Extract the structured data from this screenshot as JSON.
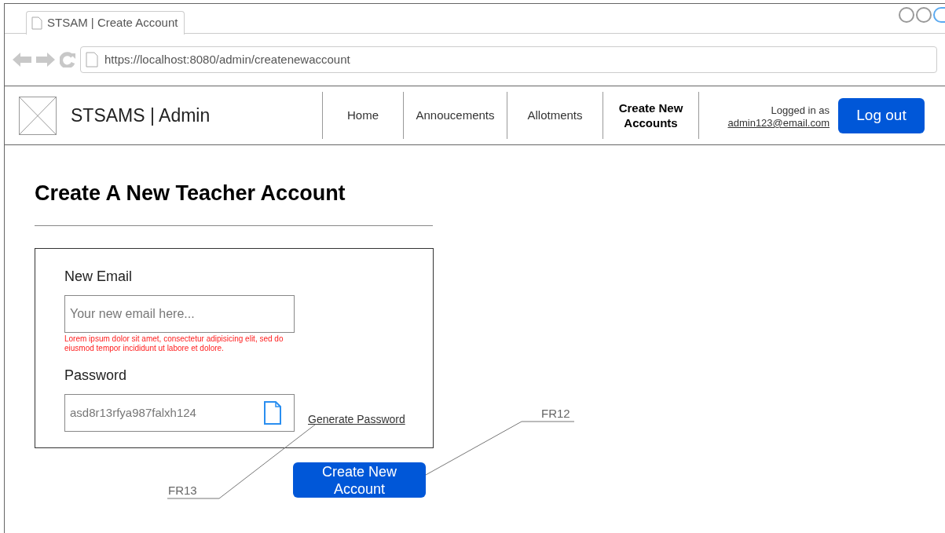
{
  "browser": {
    "tab_title": "STSAM | Create Account",
    "url": "https://localhost:8080/admin/createnewaccount"
  },
  "header": {
    "title": "STSAMS | Admin",
    "nav": [
      {
        "label": "Home",
        "selected": false
      },
      {
        "label": "Annoucements",
        "selected": false
      },
      {
        "label": "Allotments",
        "selected": false
      },
      {
        "label": "Create New Accounts",
        "selected": true
      }
    ],
    "logged_in_label": "Logged in as",
    "user_email": "admin123@email.com",
    "logout": "Log out"
  },
  "page": {
    "heading": "Create A New Teacher Account",
    "email": {
      "label": "New Email",
      "placeholder": "Your new email here...",
      "error": "Lorem ipsum dolor sit amet, consectetur adipisicing elit, sed do eiusmod tempor incididunt ut labore et dolore."
    },
    "password": {
      "label": "Password",
      "value": "asd8r13rfya987falxh124"
    },
    "generate_link": "Generate Password",
    "submit": "Create New Account"
  },
  "annotations": [
    {
      "label": "FR13"
    },
    {
      "label": "FR12"
    }
  ]
}
